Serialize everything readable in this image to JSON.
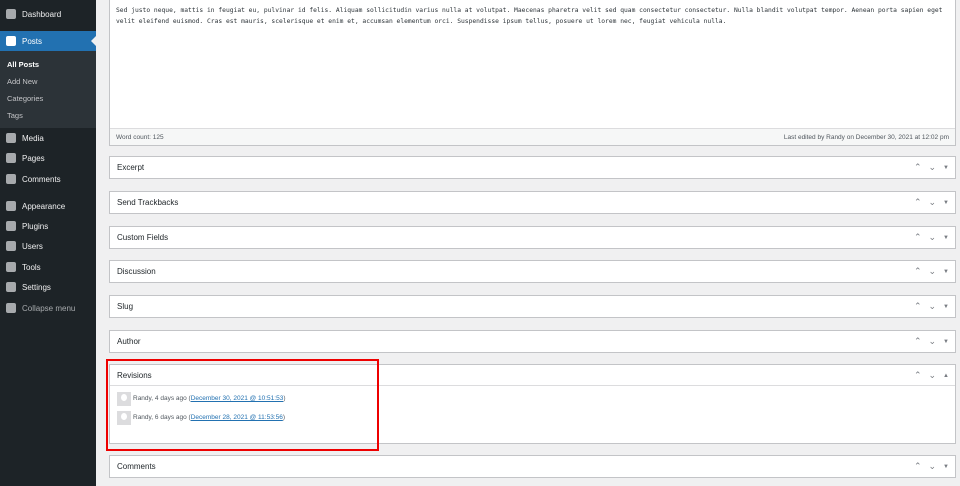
{
  "sidebar": {
    "items": [
      {
        "label": "Dashboard",
        "icon": "dashboard-icon"
      },
      {
        "label": "Posts",
        "icon": "pin-icon",
        "active": true
      },
      {
        "label": "Media",
        "icon": "media-icon"
      },
      {
        "label": "Pages",
        "icon": "pages-icon"
      },
      {
        "label": "Comments",
        "icon": "comments-icon"
      },
      {
        "label": "Appearance",
        "icon": "brush-icon"
      },
      {
        "label": "Plugins",
        "icon": "plugin-icon"
      },
      {
        "label": "Users",
        "icon": "users-icon"
      },
      {
        "label": "Tools",
        "icon": "wrench-icon"
      },
      {
        "label": "Settings",
        "icon": "settings-icon"
      },
      {
        "label": "Collapse menu",
        "icon": "collapse-icon"
      }
    ],
    "submenu": [
      "All Posts",
      "Add New",
      "Categories",
      "Tags"
    ]
  },
  "editor": {
    "text": "Sed justo neque, mattis in feugiat eu, pulvinar id felis. Aliquam sollicitudin varius nulla at volutpat. Maecenas pharetra velit sed quam consectetur consectetur. Nulla blandit volutpat tempor. Aenean porta sapien eget velit eleifend euismod. Cras est mauris, scelerisque et enim et, accumsan elementum orci. Suspendisse ipsum tellus, posuere ut lorem nec, feugiat vehicula nulla.",
    "word_count": "Word count: 125",
    "last_edited": "Last edited by Randy on December 30, 2021 at 12:02 pm"
  },
  "panels": [
    "Excerpt",
    "Send Trackbacks",
    "Custom Fields",
    "Discussion",
    "Slug",
    "Author",
    "Revisions",
    "Comments"
  ],
  "revisions": [
    {
      "author": "Randy, 4 days ago",
      "link": "December 30, 2021 @ 10:51:53"
    },
    {
      "author": "Randy, 6 days ago",
      "link": "December 28, 2021 @ 11:53:56"
    }
  ],
  "colors": {
    "sidebar": "#1d2327",
    "accent": "#2271b1",
    "highlight": "#ee0000"
  }
}
